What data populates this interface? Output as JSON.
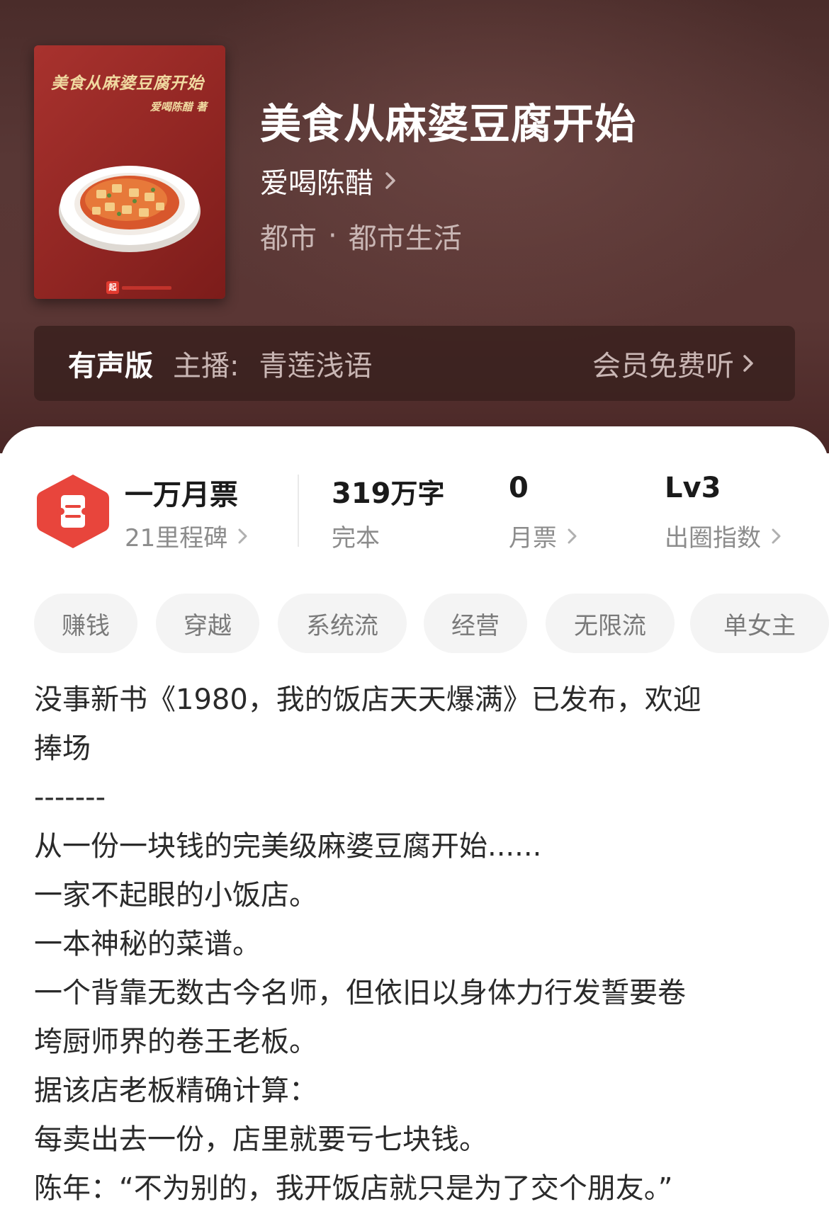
{
  "cover": {
    "title": "美食从麻婆豆腐开始",
    "author": "爱喝陈醋 著",
    "publisher_logo": "起"
  },
  "book": {
    "title": "美食从麻婆豆腐开始",
    "author": "爱喝陈醋",
    "category": "都市",
    "separator": "·",
    "subcategory": "都市生活"
  },
  "audio": {
    "badge": "有声版",
    "host_label": "主播:",
    "host_name": "青莲浅语",
    "listen": "会员免费听"
  },
  "stats": {
    "ticket": {
      "main": "一万月票",
      "sub": "21里程碑"
    },
    "words": {
      "value": "319",
      "unit": "万字",
      "sub": "完本"
    },
    "votes": {
      "value": "0",
      "sub": "月票"
    },
    "level": {
      "value": "Lv3",
      "sub": "出圈指数"
    }
  },
  "tags": [
    "赚钱",
    "穿越",
    "系统流",
    "经营",
    "无限流",
    "单女主"
  ],
  "description": {
    "lines": [
      "没事新书《1980，我的饭店天天爆满》已发布，欢迎",
      "捧场",
      "-------",
      "从一份一块钱的完美级麻婆豆腐开始......",
      "一家不起眼的小饭店。",
      "一本神秘的菜谱。",
      "一个背靠无数古今名师，但依旧以身体力行发誓要卷",
      "垮厨师界的卷王老板。",
      "据该店老板精确计算：",
      "每卖出去一份，店里就要亏七块钱。",
      "陈年：“不为别的，我开饭店就只是为了交个朋友。”"
    ]
  },
  "colors": {
    "header_bg": "#55332f",
    "cover_red": "#9a2b27",
    "badge_red": "#e8453c",
    "tag_bg": "#f4f4f4"
  }
}
